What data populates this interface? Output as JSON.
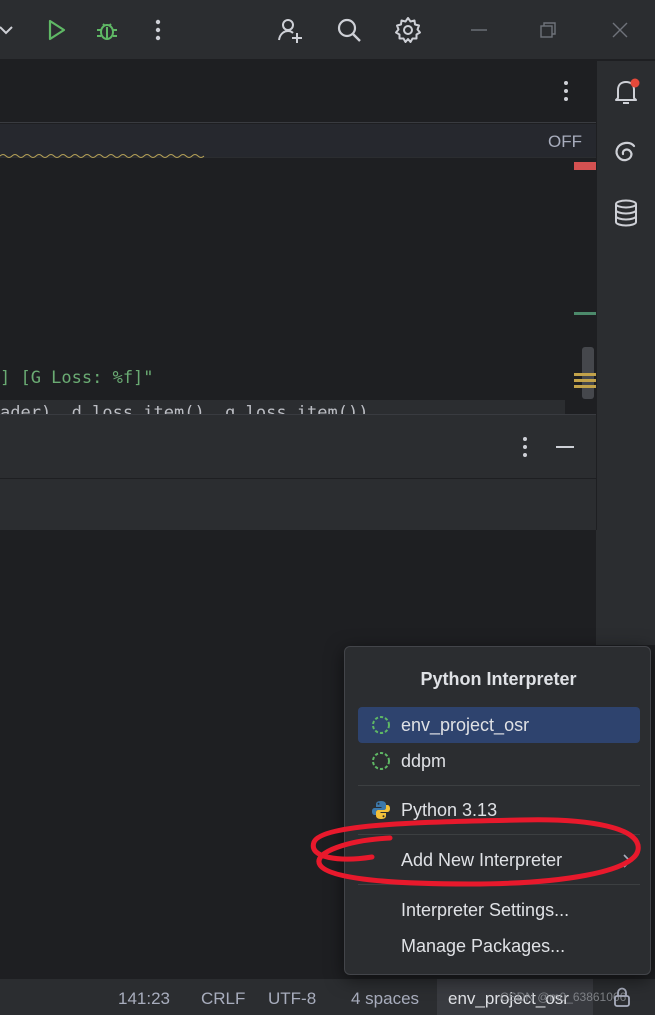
{
  "titlebar": {
    "icons": [
      "chevron-down-icon",
      "run-icon",
      "debug-icon",
      "more-vertical-icon",
      "add-user-icon",
      "search-icon",
      "gear-icon",
      "minimize-icon",
      "restore-icon",
      "close-icon"
    ]
  },
  "editor": {
    "inlay_status": "OFF",
    "code_line_1": "] [G Loss: %f]\"",
    "code_line_2": "ader), d_loss.item(), g_loss.item())"
  },
  "right_toolbar": {
    "icons": [
      "notifications-icon",
      "ai-assistant-icon",
      "database-icon"
    ]
  },
  "popup": {
    "title": "Python Interpreter",
    "items": [
      {
        "label": "env_project_osr",
        "icon": "virtualenv-icon",
        "selected": true
      },
      {
        "label": "ddpm",
        "icon": "virtualenv-icon",
        "selected": false
      },
      {
        "label": "Python 3.13",
        "icon": "python-icon",
        "selected": false
      },
      {
        "label": "Add New Interpreter",
        "icon": "",
        "selected": false
      },
      {
        "label": "Interpreter Settings...",
        "icon": "",
        "selected": false
      },
      {
        "label": "Manage Packages...",
        "icon": "",
        "selected": false
      }
    ]
  },
  "statusbar": {
    "position": "141:23",
    "line_ending": "CRLF",
    "encoding": "UTF-8",
    "indent": "4 spaces",
    "interpreter": "env_project_osr",
    "watermark": "CSDN @m0_63861066"
  },
  "colors": {
    "background": "#1e1f22",
    "panel": "#2b2d30",
    "selection": "#2e436e",
    "run_green": "#5fb865",
    "string_green": "#6aab73",
    "annotation_red": "#e8192c",
    "notification_dot": "#e5493a"
  }
}
